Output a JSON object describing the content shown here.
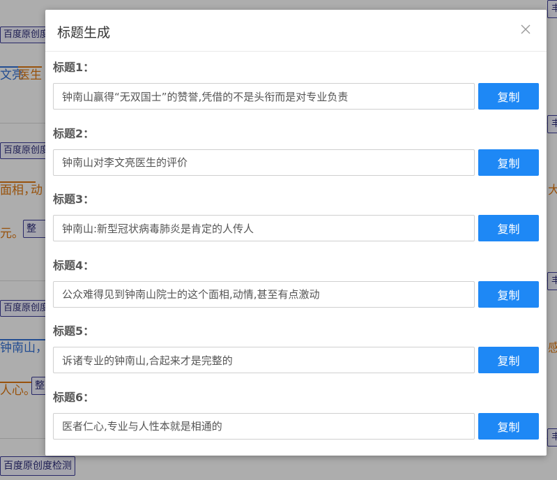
{
  "background": {
    "chip_label": "百度原创度检测",
    "chip_label_partial": "百度原创度",
    "fragments": {
      "wenliang": "文亮",
      "yisheng": "医生",
      "mianxiang": "面相，",
      "dong": "动",
      "yuan": "元。",
      "zheng": "整",
      "zhongnanshan": "钟南山，",
      "renxin": "人心。",
      "right_mark_1": "大",
      "right_mark_2": "感",
      "right_chip": "丰"
    }
  },
  "dialog": {
    "title": "标题生成",
    "copy_label": "复制",
    "items": [
      {
        "label": "标题1：",
        "value": "钟南山赢得“无双国士”的赞誉,凭借的不是头衔而是对专业负责"
      },
      {
        "label": "标题2：",
        "value": "钟南山对李文亮医生的评价"
      },
      {
        "label": "标题3：",
        "value": "钟南山:新型冠状病毒肺炎是肯定的人传人"
      },
      {
        "label": "标题4：",
        "value": "公众难得见到钟南山院士的这个面相,动情,甚至有点激动"
      },
      {
        "label": "标题5：",
        "value": "诉诸专业的钟南山,合起来才是完整的"
      },
      {
        "label": "标题6：",
        "value": "医者仁心,专业与人性本就是相通的"
      }
    ]
  }
}
